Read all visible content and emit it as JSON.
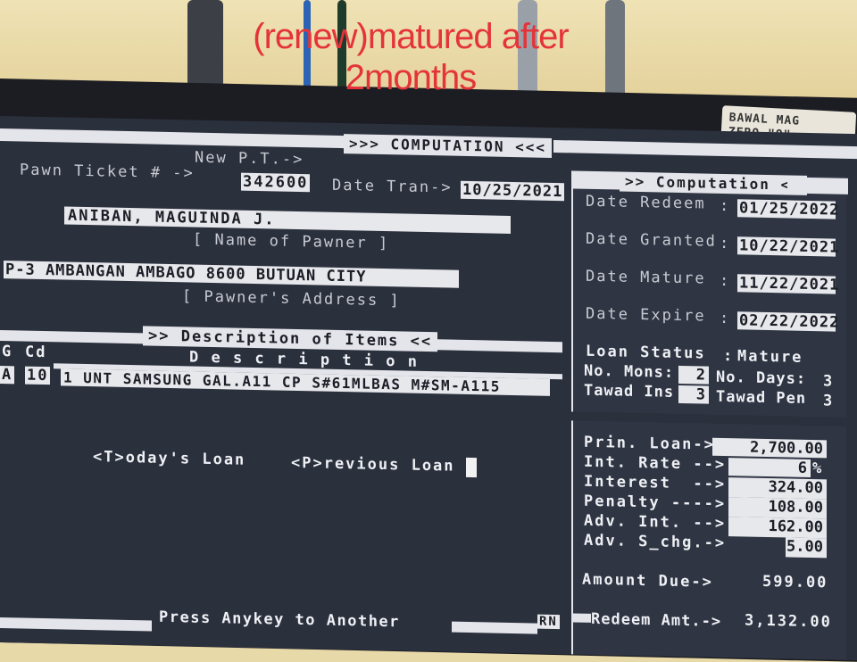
{
  "overlay_caption": {
    "line1": "(renew)matured after",
    "line2": "2months"
  },
  "sticker_text": {
    "line1": "BAWAL MAG",
    "line2": "ZERO \"O\""
  },
  "header": {
    "computation_title": ">>> COMPUTATION <<<",
    "new_pt_label": "New P.T.->",
    "pawn_ticket_label": "Pawn Ticket # ->",
    "pawn_ticket_value": "342600",
    "date_tran_label": "Date Tran->",
    "date_tran_value": "10/25/2021"
  },
  "pawner": {
    "name": "ANIBAN, MAGUINDA J.",
    "name_caption": "[ Name of Pawner ]",
    "address": "P-3 AMBANGAN AMBAGO 8600 BUTUAN CITY",
    "address_caption": "[ Pawner's Address ]"
  },
  "items": {
    "section_title": ">> Description of Items <<",
    "col_g": "G",
    "col_cd": "Cd",
    "col_description": "D e s c r i p t i o n",
    "rows": [
      {
        "g": "A",
        "cd": "10",
        "description": "1 UNT SAMSUNG GAL.A11 CP S#61MLBAS M#SM-A115"
      }
    ]
  },
  "loan_options": {
    "today": "<T>oday's Loan",
    "previous": "<P>revious Loan"
  },
  "computation": {
    "title": ">> Computation <<",
    "date_redeem_label": "Date Redeem",
    "date_redeem": "01/25/2022",
    "date_granted_label": "Date Granted",
    "date_granted": "10/22/2021",
    "date_mature_label": "Date Mature",
    "date_mature": "11/22/2021",
    "date_expire_label": "Date Expire",
    "date_expire": "02/22/2022",
    "loan_status_label": "Loan Status",
    "loan_status": "Mature",
    "no_mons_label": "No. Mons:",
    "no_mons": "2",
    "no_days_label": "No. Days:",
    "no_days": "3",
    "tawad_ins_label": "Tawad Ins",
    "tawad_ins": "3",
    "tawad_pen_label": "Tawad Pen",
    "tawad_pen": "3",
    "separator": ":"
  },
  "amounts": {
    "prin_loan_label": "Prin. Loan->",
    "prin_loan": "2,700.00",
    "int_rate_label": "Int. Rate -->",
    "int_rate": "6",
    "int_rate_unit": "%",
    "interest_label": "Interest  -->",
    "interest": "324.00",
    "penalty_label": "Penalty ---->",
    "penalty": "108.00",
    "adv_int_label": "Adv. Int. -->",
    "adv_int": "162.00",
    "adv_schg_label": "Adv. S_chg.->",
    "adv_schg": "5.00",
    "amount_due_label": "Amount Due->",
    "amount_due": "599.00",
    "redeem_amt_label": "Redeem Amt.->",
    "redeem_amt": "3,132.00"
  },
  "footer": {
    "prompt": "Press Anykey to Another",
    "code": "RN"
  },
  "colors": {
    "screen_bg": "#2b303d",
    "highlight_bg": "#e7e8ec",
    "caption_red": "#e4343a"
  }
}
